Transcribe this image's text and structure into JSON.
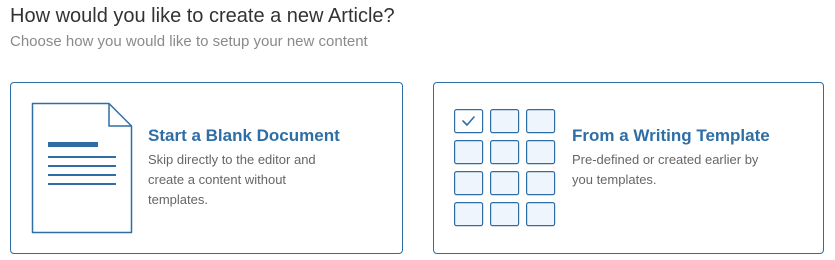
{
  "page": {
    "title": "How would you like to create a new Article?",
    "subtitle": "Choose how you would like to setup your new content"
  },
  "options": {
    "blank": {
      "title": "Start a Blank Document",
      "description": "Skip directly to the editor and create a content without templates.",
      "icon": "document-icon"
    },
    "template": {
      "title": "From a Writing Template",
      "description": "Pre-defined or created earlier by you templates.",
      "icon": "template-grid-icon"
    }
  },
  "colors": {
    "accent": "#2f6ea5",
    "border": "#2e6da4",
    "tile_fill": "#eef5fc"
  }
}
